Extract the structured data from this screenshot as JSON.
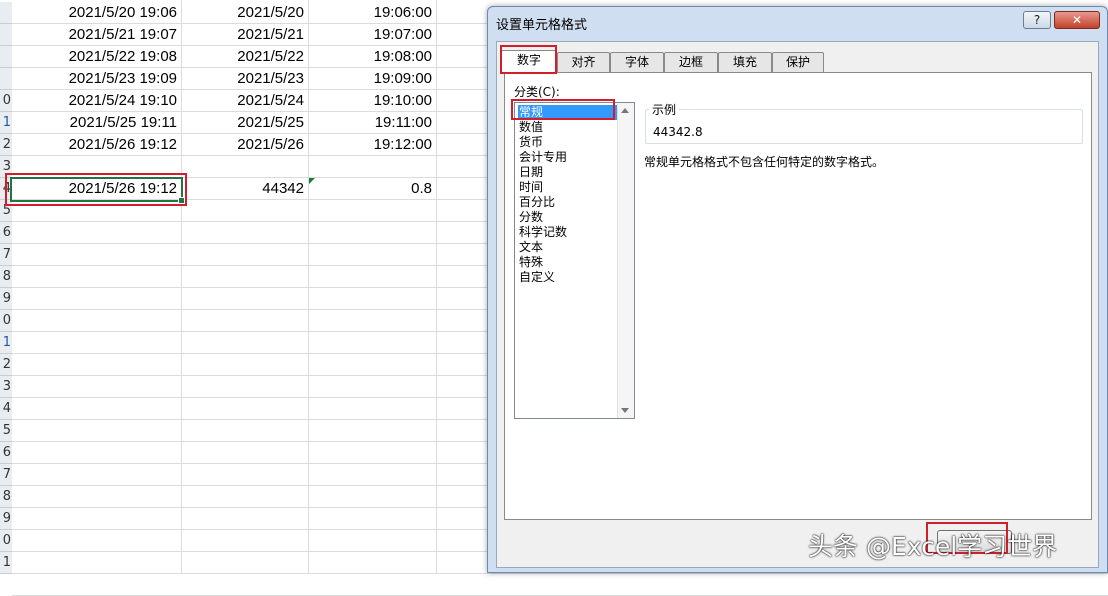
{
  "sheet": {
    "row_headers": [
      {
        "label": "",
        "sel": false
      },
      {
        "label": "",
        "sel": false
      },
      {
        "label": "",
        "sel": false
      },
      {
        "label": "",
        "sel": false
      },
      {
        "label": "0",
        "sel": false
      },
      {
        "label": "1",
        "sel": true
      },
      {
        "label": "2",
        "sel": false
      },
      {
        "label": "3",
        "sel": false
      },
      {
        "label": "4",
        "sel": false
      },
      {
        "label": "5",
        "sel": false
      },
      {
        "label": "6",
        "sel": false
      },
      {
        "label": "7",
        "sel": false
      },
      {
        "label": "8",
        "sel": false
      },
      {
        "label": "9",
        "sel": false
      },
      {
        "label": "0",
        "sel": false
      },
      {
        "label": "1",
        "sel": true
      },
      {
        "label": "2",
        "sel": false
      },
      {
        "label": "3",
        "sel": false
      },
      {
        "label": "4",
        "sel": false
      },
      {
        "label": "5",
        "sel": false
      },
      {
        "label": "6",
        "sel": false
      },
      {
        "label": "7",
        "sel": false
      },
      {
        "label": "8",
        "sel": false
      },
      {
        "label": "9",
        "sel": false
      },
      {
        "label": "0",
        "sel": false
      },
      {
        "label": "1",
        "sel": false
      }
    ],
    "rows": [
      [
        "2021/5/20 19:06",
        "2021/5/20",
        "19:06:00"
      ],
      [
        "2021/5/21 19:07",
        "2021/5/21",
        "19:07:00"
      ],
      [
        "2021/5/22 19:08",
        "2021/5/22",
        "19:08:00"
      ],
      [
        "2021/5/23 19:09",
        "2021/5/23",
        "19:09:00"
      ],
      [
        "2021/5/24 19:10",
        "2021/5/24",
        "19:10:00"
      ],
      [
        "2021/5/25 19:11",
        "2021/5/25",
        "19:11:00"
      ],
      [
        "2021/5/26 19:12",
        "2021/5/26",
        "19:12:00"
      ],
      [
        "",
        "",
        ""
      ],
      [
        "2021/5/26 19:12",
        "44342",
        "0.8"
      ]
    ]
  },
  "dialog": {
    "title": "设置单元格格式",
    "help_label": "?",
    "close_label": "✕",
    "tabs": [
      "数字",
      "对齐",
      "字体",
      "边框",
      "填充",
      "保护"
    ],
    "category_label": "分类(C):",
    "categories": [
      "常规",
      "数值",
      "货币",
      "会计专用",
      "日期",
      "时间",
      "百分比",
      "分数",
      "科学记数",
      "文本",
      "特殊",
      "自定义"
    ],
    "selected_category": "常规",
    "sample_label": "示例",
    "sample_value": "44342.8",
    "description": "常规单元格格式不包含任何特定的数字格式。"
  },
  "watermark": "头条 @Excel学习世界",
  "colors": {
    "selection": "#3399ff",
    "highlight_box": "#d21e2b",
    "active_cell_border": "#217346"
  }
}
